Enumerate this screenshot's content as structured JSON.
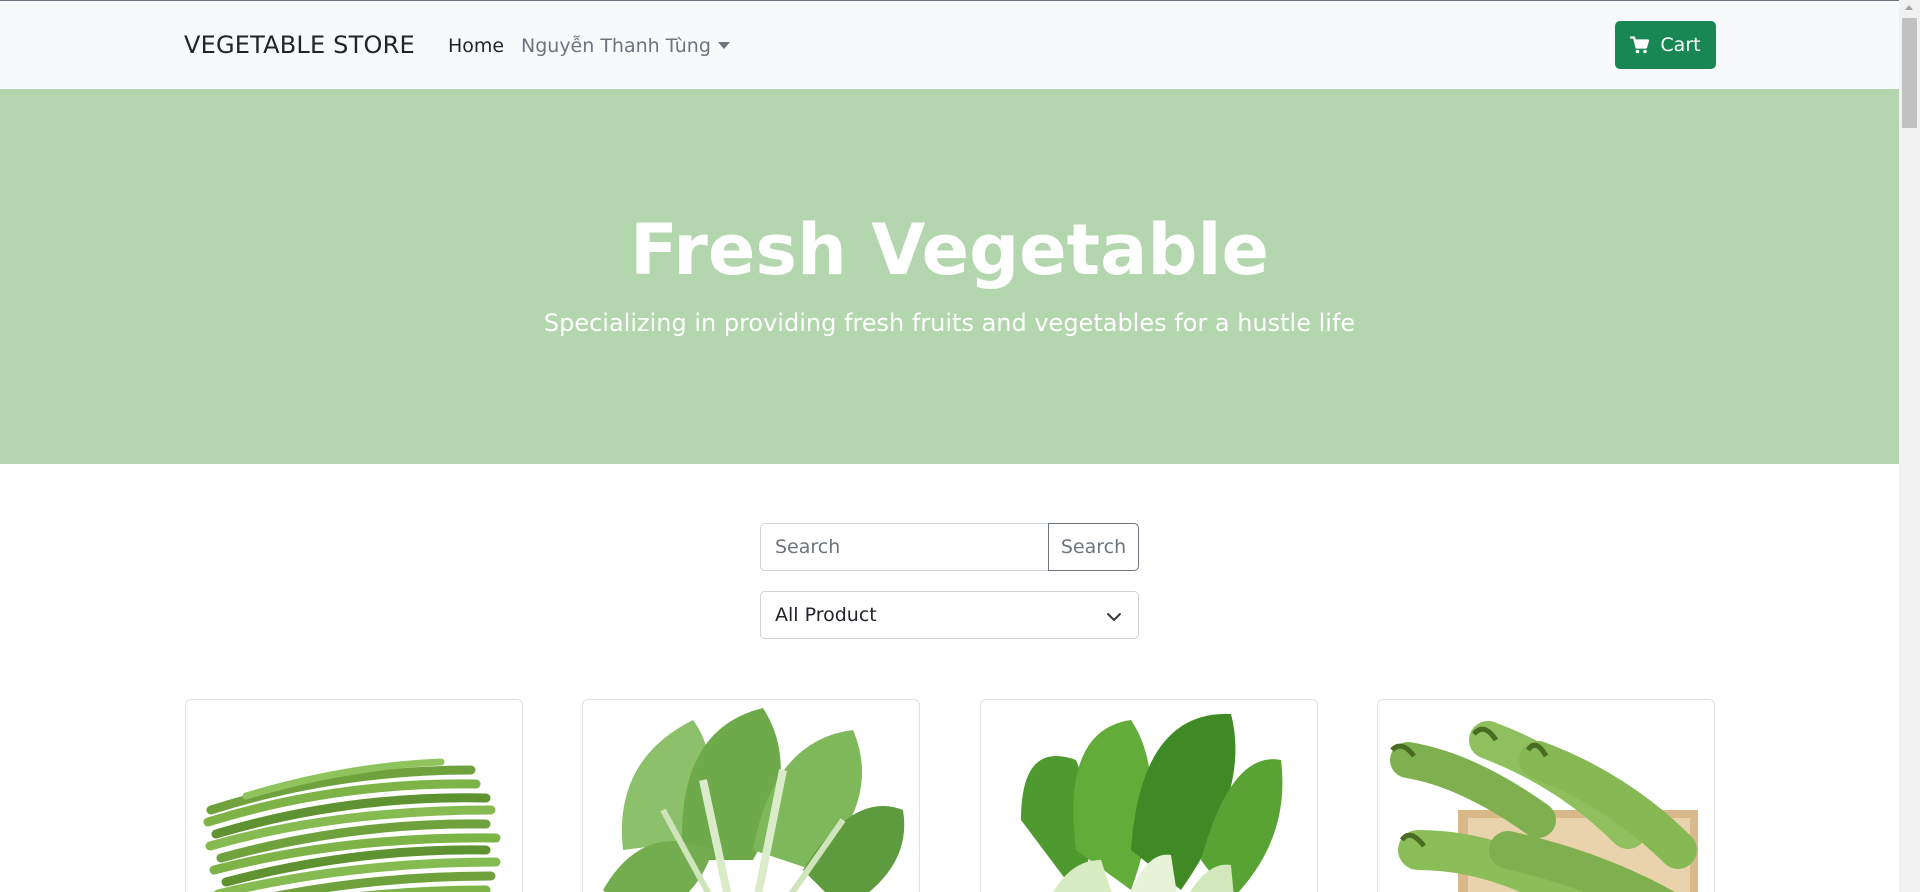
{
  "navbar": {
    "brand": "VEGETABLE STORE",
    "home_label": "Home",
    "user_label": "Nguyễn Thanh Tùng",
    "cart_label": "Cart",
    "cart_icon": "cart-icon",
    "accent_color": "#198754"
  },
  "hero": {
    "title": "Fresh Vegetable",
    "subtitle": "Specializing in providing fresh fruits and vegetables for a hustle life",
    "background_color": "#b4d6ae"
  },
  "search": {
    "placeholder": "Search",
    "button_label": "Search"
  },
  "filter": {
    "selected": "All Product",
    "icon": "chevron-down-icon"
  },
  "products": [
    {
      "image": "green-beans"
    },
    {
      "image": "mustard-greens"
    },
    {
      "image": "bok-choy"
    },
    {
      "image": "bottle-gourd"
    }
  ]
}
